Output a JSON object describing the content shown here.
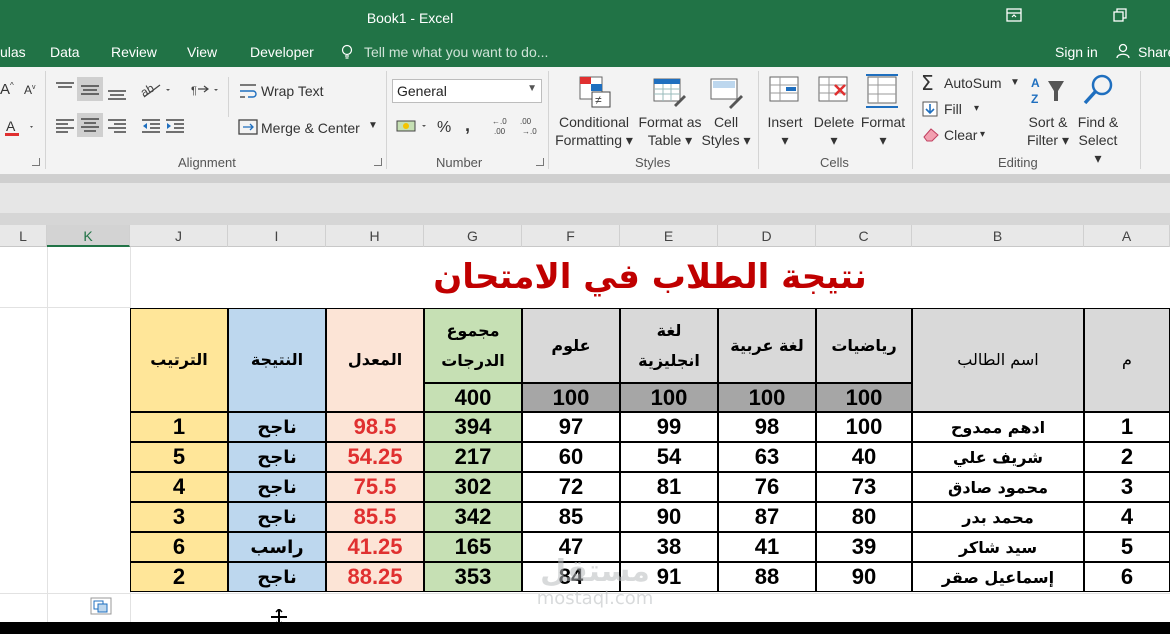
{
  "window": {
    "title": "Book1 - Excel",
    "restore_icon": "ribbon-display-icon",
    "maximize_icon": "restore-window-icon"
  },
  "menu": {
    "tabs": [
      "ulas",
      "Data",
      "Review",
      "View",
      "Developer"
    ],
    "tell_me": "Tell me what you want to do...",
    "sign_in": "Sign in",
    "share": "Share"
  },
  "ribbon": {
    "alignment": {
      "wrap_text": "Wrap Text",
      "merge_center": "Merge & Center",
      "label": "Alignment"
    },
    "number": {
      "format_value": "General",
      "percent": "%",
      "comma": ",",
      "label": "Number"
    },
    "styles": {
      "conditional_formatting": [
        "Conditional",
        "Formatting"
      ],
      "format_as_table": [
        "Format as",
        "Table"
      ],
      "cell_styles": [
        "Cell",
        "Styles"
      ],
      "label": "Styles"
    },
    "cells": {
      "insert": "Insert",
      "delete": "Delete",
      "format": "Format",
      "label": "Cells"
    },
    "editing": {
      "autosum": "AutoSum",
      "fill": "Fill",
      "clear": "Clear",
      "sort_filter": [
        "Sort &",
        "Filter"
      ],
      "find_select": [
        "Find &",
        "Select"
      ],
      "label": "Editing"
    }
  },
  "columns": [
    "L",
    "K",
    "J",
    "I",
    "H",
    "G",
    "F",
    "E",
    "D",
    "C",
    "B",
    "A"
  ],
  "selected_column": "K",
  "sheet": {
    "title": "نتيجة الطلاب في الامتحان",
    "headers": {
      "rank": "الترتيب",
      "result": "النتيجة",
      "average": "المعدل",
      "total_line1": "مجموع",
      "total_line2": "الدرجات",
      "science": "علوم",
      "english_line1": "لغة",
      "english_line2": "انجليزية",
      "arabic": "لغة عربية",
      "math": "رياضيات",
      "student_name": "اسم الطالب",
      "number": "م"
    },
    "max_marks": {
      "total": "400",
      "science": "100",
      "english": "100",
      "arabic": "100",
      "math": "100"
    },
    "rows": [
      {
        "no": "1",
        "name": "ادهم ممدوح",
        "math": "100",
        "arabic": "98",
        "english": "99",
        "science": "97",
        "total": "394",
        "average": "98.5",
        "result": "ناجح",
        "rank": "1"
      },
      {
        "no": "2",
        "name": "شريف علي",
        "math": "40",
        "arabic": "63",
        "english": "54",
        "science": "60",
        "total": "217",
        "average": "54.25",
        "result": "ناجح",
        "rank": "5"
      },
      {
        "no": "3",
        "name": "محمود صادق",
        "math": "73",
        "arabic": "76",
        "english": "81",
        "science": "72",
        "total": "302",
        "average": "75.5",
        "result": "ناجح",
        "rank": "4"
      },
      {
        "no": "4",
        "name": "محمد بدر",
        "math": "80",
        "arabic": "87",
        "english": "90",
        "science": "85",
        "total": "342",
        "average": "85.5",
        "result": "ناجح",
        "rank": "3"
      },
      {
        "no": "5",
        "name": "سيد شاكر",
        "math": "39",
        "arabic": "41",
        "english": "38",
        "science": "47",
        "total": "165",
        "average": "41.25",
        "result": "راسب",
        "rank": "6"
      },
      {
        "no": "6",
        "name": "إسماعيل صقر",
        "math": "90",
        "arabic": "88",
        "english": "91",
        "science": "84",
        "total": "353",
        "average": "88.25",
        "result": "ناجح",
        "rank": "2"
      }
    ]
  },
  "watermark": {
    "arabic": "مستقل",
    "latin": "mostaql.com"
  },
  "colors": {
    "excel_green": "#217346",
    "title_red": "#c00000",
    "average_red": "#e03030",
    "rank_yellow": "#ffe699",
    "result_blue": "#bdd7ee",
    "average_pink": "#fce4d6",
    "total_green": "#c6e0b4",
    "header_gray": "#d9d9d9",
    "max_gray": "#a6a6a6"
  }
}
